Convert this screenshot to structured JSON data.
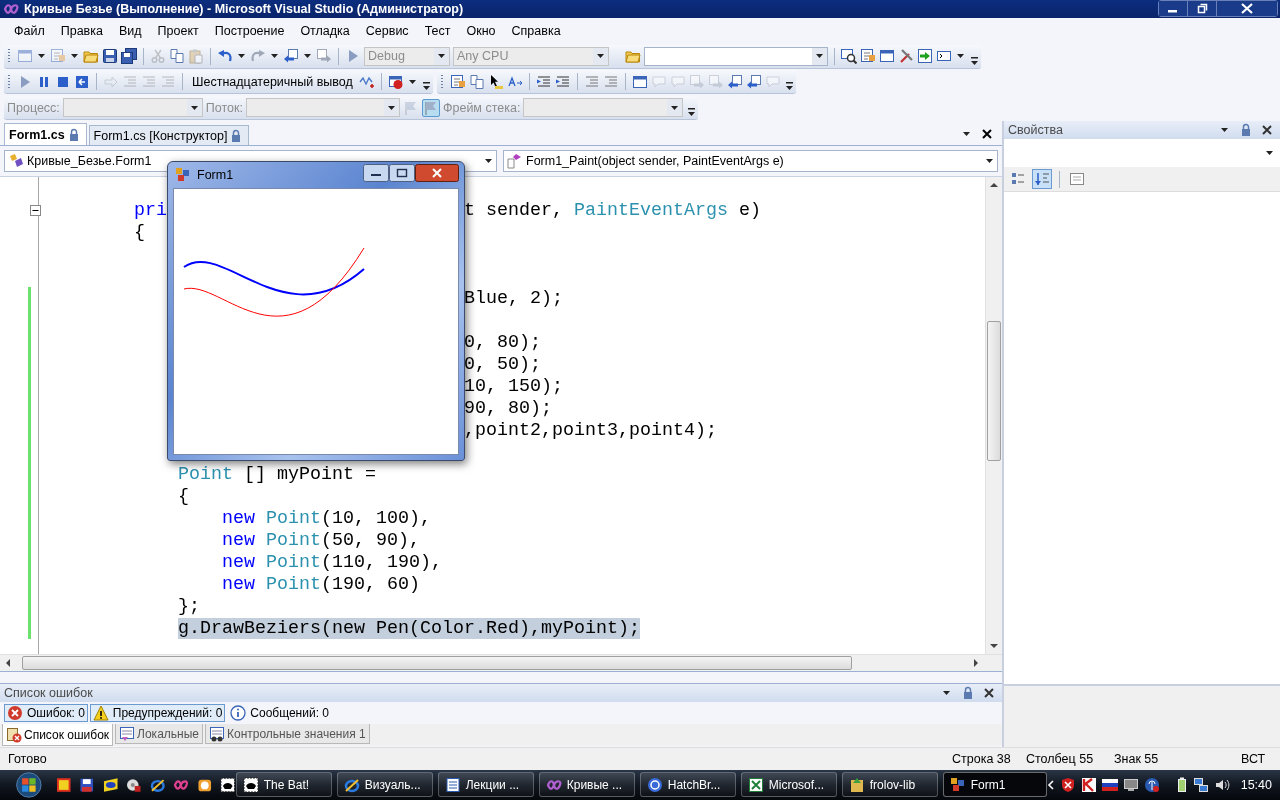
{
  "window": {
    "title": "Кривые Безье (Выполнение) - Microsoft Visual Studio (Администратор)"
  },
  "menu": [
    "Файл",
    "Правка",
    "Вид",
    "Проект",
    "Построение",
    "Отладка",
    "Сервис",
    "Тест",
    "Окно",
    "Справка"
  ],
  "toolbar": {
    "configuration": {
      "value": "Debug",
      "disabled": true
    },
    "platform": {
      "value": "Any CPU",
      "disabled": true
    },
    "hex_button": "Шестнадцатеричный вывод",
    "debug_location": [
      {
        "label": "Процесс:",
        "disabled": true
      },
      {
        "label": "Поток:",
        "disabled": true
      },
      {
        "label": "Фрейм стека:",
        "disabled": true
      }
    ]
  },
  "editor": {
    "tabs": [
      {
        "label": "Form1.cs",
        "selected": true
      },
      {
        "label": "Form1.cs [Конструктор]",
        "selected": false
      }
    ],
    "class_selector": "Кривые_Безье.Form1",
    "member_selector": "Form1_Paint(object sender, PaintEventArgs e)",
    "lines": [
      {
        "changed": false
      },
      {
        "changed": false,
        "collapsible": true,
        "left": [
          {
            "text": "        pri",
            "kind": "keyword"
          }
        ],
        "right": [
          {
            "text": "t sender, ",
            "kind": "plain"
          },
          {
            "text": "PaintEventArgs",
            "kind": "type"
          },
          {
            "text": " e)",
            "kind": "plain"
          }
        ]
      },
      {
        "changed": false,
        "left": [
          {
            "text": "        {",
            "kind": "plain"
          }
        ]
      },
      {
        "changed": false
      },
      {
        "changed": false
      },
      {
        "changed": true,
        "right": [
          {
            "text": "Blue, 2);",
            "kind": "plain"
          }
        ]
      },
      {
        "changed": true
      },
      {
        "changed": true,
        "right": [
          {
            "text": "0, 80);",
            "kind": "plain"
          }
        ]
      },
      {
        "changed": true,
        "right": [
          {
            "text": "0, 50);",
            "kind": "plain"
          }
        ]
      },
      {
        "changed": true,
        "right": [
          {
            "text": "10, 150);",
            "kind": "plain"
          }
        ]
      },
      {
        "changed": true,
        "right": [
          {
            "text": "90, 80);",
            "kind": "plain"
          }
        ]
      },
      {
        "changed": true,
        "right": [
          {
            "text": ",point2,point3,point4);",
            "kind": "plain"
          }
        ]
      },
      {
        "changed": true
      },
      {
        "changed": true,
        "left": [
          {
            "text": "            Point",
            "kind": "type"
          },
          {
            "text": " [] myPoint =",
            "kind": "plain"
          }
        ]
      },
      {
        "changed": true,
        "left": [
          {
            "text": "            {",
            "kind": "plain"
          }
        ]
      },
      {
        "changed": true,
        "left": [
          {
            "text": "                new",
            "kind": "keyword"
          },
          {
            "text": " Point",
            "kind": "type"
          },
          {
            "text": "(10, 100),",
            "kind": "plain"
          }
        ]
      },
      {
        "changed": true,
        "left": [
          {
            "text": "                new",
            "kind": "keyword"
          },
          {
            "text": " Point",
            "kind": "type"
          },
          {
            "text": "(50, 90),",
            "kind": "plain"
          }
        ]
      },
      {
        "changed": true,
        "left": [
          {
            "text": "                new",
            "kind": "keyword"
          },
          {
            "text": " Point",
            "kind": "type"
          },
          {
            "text": "(110, 190),",
            "kind": "plain"
          }
        ]
      },
      {
        "changed": true,
        "left": [
          {
            "text": "                new",
            "kind": "keyword"
          },
          {
            "text": " Point",
            "kind": "type"
          },
          {
            "text": "(190, 60)",
            "kind": "plain"
          }
        ]
      },
      {
        "changed": true,
        "left": [
          {
            "text": "            };",
            "kind": "plain"
          }
        ]
      },
      {
        "changed": true,
        "highlighted": true,
        "left": [
          {
            "text": "            g.DrawBeziers(new Pen(Color.Red),myPoint);",
            "kind": "plain"
          }
        ]
      }
    ]
  },
  "form_window": {
    "title": "Form1"
  },
  "properties": {
    "title": "Свойства",
    "tools": [
      {
        "kind": "categorized",
        "selected": false
      },
      {
        "kind": "alphabetical",
        "selected": true
      },
      {
        "kind": "pages",
        "selected": false
      }
    ]
  },
  "error_list": {
    "title": "Список ошибок",
    "filters": [
      {
        "kind": "errors",
        "label": "Ошибок: 0",
        "selected": true
      },
      {
        "kind": "warnings",
        "label": "Предупреждений: 0",
        "selected": true
      },
      {
        "kind": "messages",
        "label": "Сообщений: 0",
        "selected": false
      }
    ]
  },
  "bottom_tabs": [
    {
      "label": "Список ошибок",
      "selected": true
    },
    {
      "label": "Локальные",
      "selected": false
    },
    {
      "label": "Контрольные значения 1",
      "selected": false
    }
  ],
  "status_bar": {
    "message": "Готово",
    "line": "Строка 38",
    "column": "Столбец 55",
    "char": "Знак 55",
    "mode": "ВСТ"
  },
  "taskbar": {
    "tasks": [
      {
        "label": "The Bat!",
        "selected": false
      },
      {
        "label": "Визуаль...",
        "selected": false
      },
      {
        "label": "Лекции ...",
        "selected": false
      },
      {
        "label": "Кривые ...",
        "selected": false
      },
      {
        "label": "HatchBr...",
        "selected": false
      },
      {
        "label": "Microsof...",
        "selected": false
      },
      {
        "label": "frolov-lib",
        "selected": false
      },
      {
        "label": "Form1",
        "selected": true
      }
    ],
    "clock": "15:40"
  }
}
